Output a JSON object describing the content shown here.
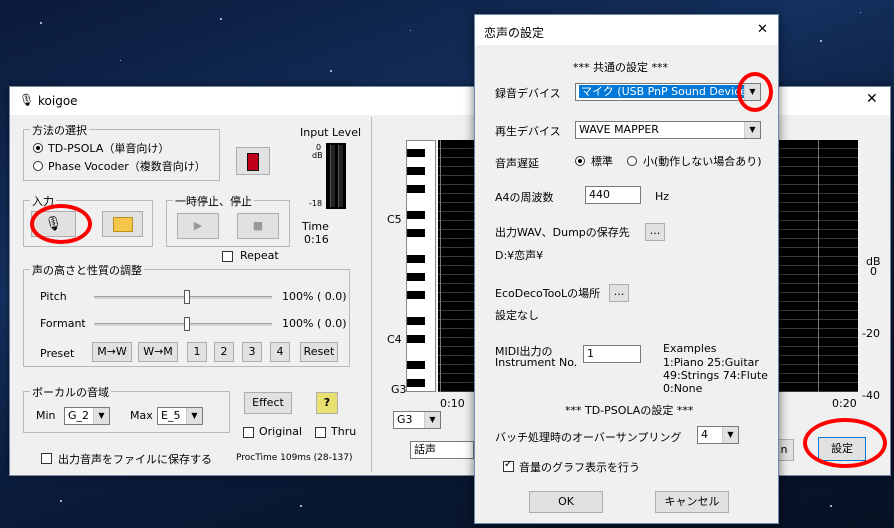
{
  "main_window": {
    "title": "koigoe",
    "method_group": "方法の選択",
    "method_options": [
      "TD-PSOLA（単音向け）",
      "Phase Vocoder（複数音向け）"
    ],
    "input_level_label": "Input Level",
    "input_level_scale": {
      "top": "0",
      "unit": "dB",
      "bottom": "-18"
    },
    "input_group": "入力",
    "pause_group": "一時停止、停止",
    "time_label": "Time",
    "time_value": "0:16",
    "repeat_label": "Repeat",
    "pitch_group": "声の高さと性質の調整",
    "pitch_label": "Pitch",
    "pitch_value": "100% ( 0.0)",
    "formant_label": "Formant",
    "formant_value": "100% ( 0.0)",
    "preset_label": "Preset",
    "preset_buttons": [
      "M→W",
      "W→M",
      "1",
      "2",
      "3",
      "4",
      "Reset"
    ],
    "vocal_group": "ボーカルの音域",
    "min_label": "Min",
    "min_value": "G_2",
    "max_label": "Max",
    "max_value": "E_5",
    "effect_button": "Effect",
    "help_button": "?",
    "original_label": "Original",
    "thru_label": "Thru",
    "save_output_label": "出力音声をファイルに保存する",
    "proctime": "ProcTime 109ms (28-137)",
    "note_labels": [
      "C5",
      "C4",
      "G3"
    ],
    "time_ticks": [
      "0:10",
      "0:20"
    ],
    "db_scale": {
      "unit": "dB",
      "values": [
        "0",
        "-20",
        "-40"
      ]
    },
    "note_select": "G3",
    "voice_field": "話声",
    "partial_button": "n",
    "settings_button": "設定"
  },
  "dialog": {
    "title": "恋声の設定",
    "common_header": "*** 共通の設定 ***",
    "rec_device_label": "録音デバイス",
    "rec_device_value": "マイク (USB PnP Sound Device)",
    "play_device_label": "再生デバイス",
    "play_device_value": "WAVE MAPPER",
    "latency_label": "音声遅延",
    "latency_options": [
      "標準",
      "小(動作しない場合あり)"
    ],
    "a4_label": "A4の周波数",
    "a4_value": "440",
    "a4_unit": "Hz",
    "wav_dest_label": "出力WAV、Dumpの保存先",
    "browse": "...",
    "wav_dest_value": "D:¥恋声¥",
    "ecodeco_label": "EcoDecoTooLの場所",
    "ecodeco_value": "設定なし",
    "midi_label_1": "MIDI出力の",
    "midi_label_2": "Instrument No.",
    "midi_value": "1",
    "examples_title": "Examples",
    "examples": [
      "1:Piano  25:Guitar",
      "49:Strings  74:Flute",
      "0:None"
    ],
    "psola_header": "*** TD-PSOLAの設定 ***",
    "oversampling_label": "バッチ処理時のオーバーサンプリング",
    "oversampling_value": "4",
    "graph_label": "音量のグラフ表示を行う",
    "ok": "OK",
    "cancel": "キャンセル",
    "close": "✕"
  },
  "colors": {
    "annotation": "#ff0000",
    "selection": "#0078d7"
  }
}
